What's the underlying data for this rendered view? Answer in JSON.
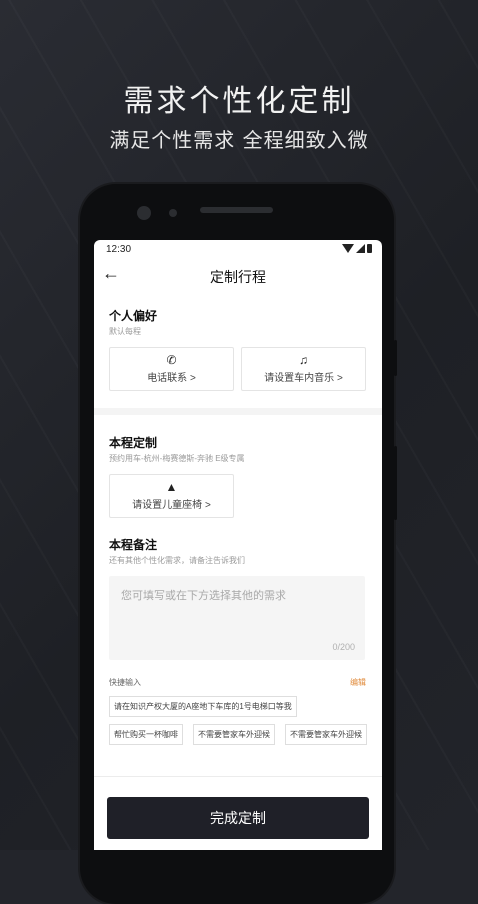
{
  "promo": {
    "headline": "需求个性化定制",
    "subheadline": "满足个性需求 全程细致入微"
  },
  "status_bar": {
    "time": "12:30"
  },
  "nav": {
    "title": "定制行程"
  },
  "preferences": {
    "title": "个人偏好",
    "subtitle": "默认每程",
    "phone_label": "电话联系 >",
    "music_label": "请设置车内音乐 >"
  },
  "trip": {
    "title": "本程定制",
    "subtitle": "预约用车-杭州-梅赛德斯-奔驰 E级专属",
    "child_seat_label": "请设置儿童座椅 >"
  },
  "notes": {
    "title": "本程备注",
    "subtitle": "还有其他个性化需求，请备注告诉我们",
    "placeholder": "您可填写或在下方选择其他的需求",
    "counter": "0/200"
  },
  "quick_input": {
    "label": "快捷输入",
    "edit": "编辑",
    "chips": [
      "请在知识产权大厦的A座地下车库的1号电梯口等我",
      "帮忙购买一杯咖啡",
      "不需要管家车外迎候",
      "不需要管家车外迎候"
    ]
  },
  "submit_label": "完成定制"
}
